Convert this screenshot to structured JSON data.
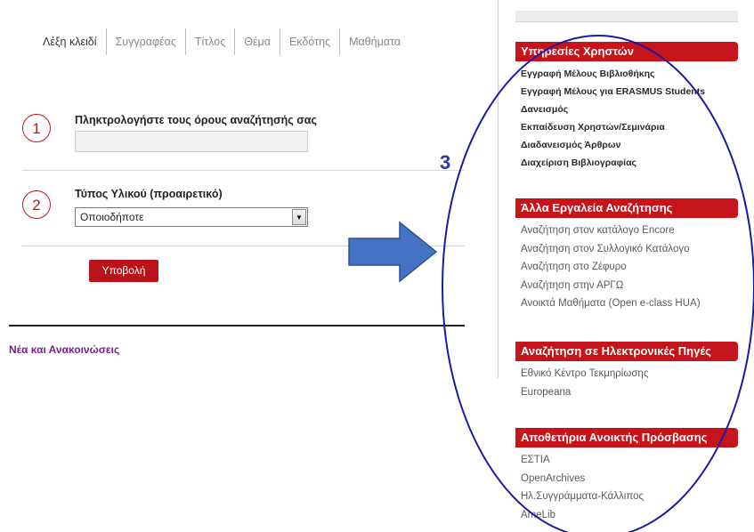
{
  "tabs": [
    {
      "label": "Λέξη κλειδί",
      "active": true
    },
    {
      "label": "Συγγραφέας",
      "active": false
    },
    {
      "label": "Τίτλος",
      "active": false
    },
    {
      "label": "Θέμα",
      "active": false
    },
    {
      "label": "Εκδότης",
      "active": false
    },
    {
      "label": "Μαθήματα",
      "active": false
    }
  ],
  "step1": {
    "number": "1",
    "label": "Πληκτρολογήστε τους όρους αναζήτησής σας",
    "value": ""
  },
  "step2": {
    "number": "2",
    "label": "Τύπος Υλικού (προαιρετικό)",
    "selected": "Οποιοδήποτε"
  },
  "submit_label": "Υποβολή",
  "news_label": "Νέα και Ανακοινώσεις",
  "sidebar": {
    "sections": [
      {
        "title": "Υπηρεσίες Χρηστών",
        "items": [
          "Εγγραφή Μέλους Βιβλιοθήκης",
          "Εγγραφή Μέλους για ERASMUS Students",
          "Δανεισμός",
          "Εκπαίδευση Χρηστών/Σεμινάρια",
          "Διαδανεισμός Άρθρων",
          "Διαχείριση Βιβλιογραφίας"
        ]
      },
      {
        "title": "Άλλα Εργαλεία Αναζήτησης",
        "items": [
          "Αναζήτηση στον κατάλογο Encore",
          "Αναζήτηση στον Συλλογικό Κατάλογο",
          "Αναζήτηση στο Ζέφυρο",
          "Αναζήτηση στην ΑΡΓΩ",
          "Ανοικτά Μαθήματα (Open e-class HUA)"
        ]
      },
      {
        "title": "Αναζήτηση σε Ηλεκτρονικές Πηγές",
        "items": [
          "Εθνικό Κέντρο Τεκμηρίωσης",
          "Europeana"
        ]
      },
      {
        "title": "Αποθετήρια Ανοικτής Πρόσβασης",
        "items": [
          "ΕΣΤΙΑ",
          "OpenArchives",
          "Ηλ.Συγγράμματα-Κάλλιπος",
          "AmeLib"
        ]
      }
    ]
  },
  "annotation": {
    "number": "3",
    "color": "#2a3ba0",
    "arrow_color": "#4472c4"
  },
  "colors": {
    "accent": "#c5141a",
    "news": "#7a1e8c"
  }
}
